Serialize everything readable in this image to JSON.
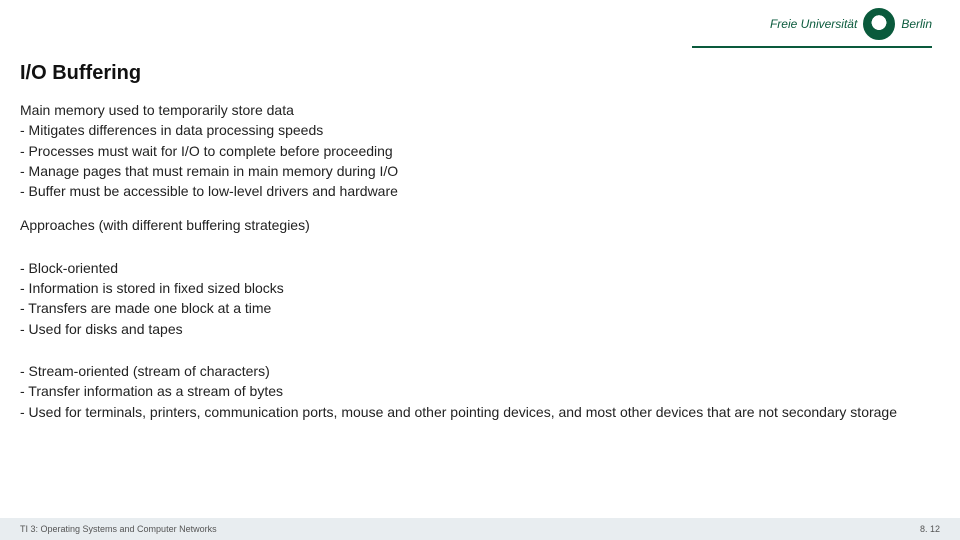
{
  "logo": {
    "left": "Freie Universität",
    "right": "Berlin"
  },
  "title": "I/O Buffering",
  "body": {
    "l0": "Main memory used to temporarily store data",
    "l1": "- Mitigates differences in data processing speeds",
    "l2": "- Processes must wait for I/O to complete before proceeding",
    "l3": "- Manage pages that must remain in main memory during I/O",
    "l4": "- Buffer must be accessible to low-level drivers and hardware",
    "l5": "Approaches (with different buffering strategies)",
    "l6": "- Block-oriented",
    "l7": "- Information is stored in fixed sized blocks",
    "l8": "- Transfers are made one block at a time",
    "l9": "- Used for disks and tapes",
    "l10": "- Stream-oriented (stream of characters)",
    "l11": "- Transfer information as a stream of bytes",
    "l12": "- Used for terminals, printers, communication ports, mouse and other pointing devices, and most other devices that are not secondary storage"
  },
  "footer": {
    "left": "TI 3: Operating Systems and Computer Networks",
    "right": "8. 12"
  }
}
